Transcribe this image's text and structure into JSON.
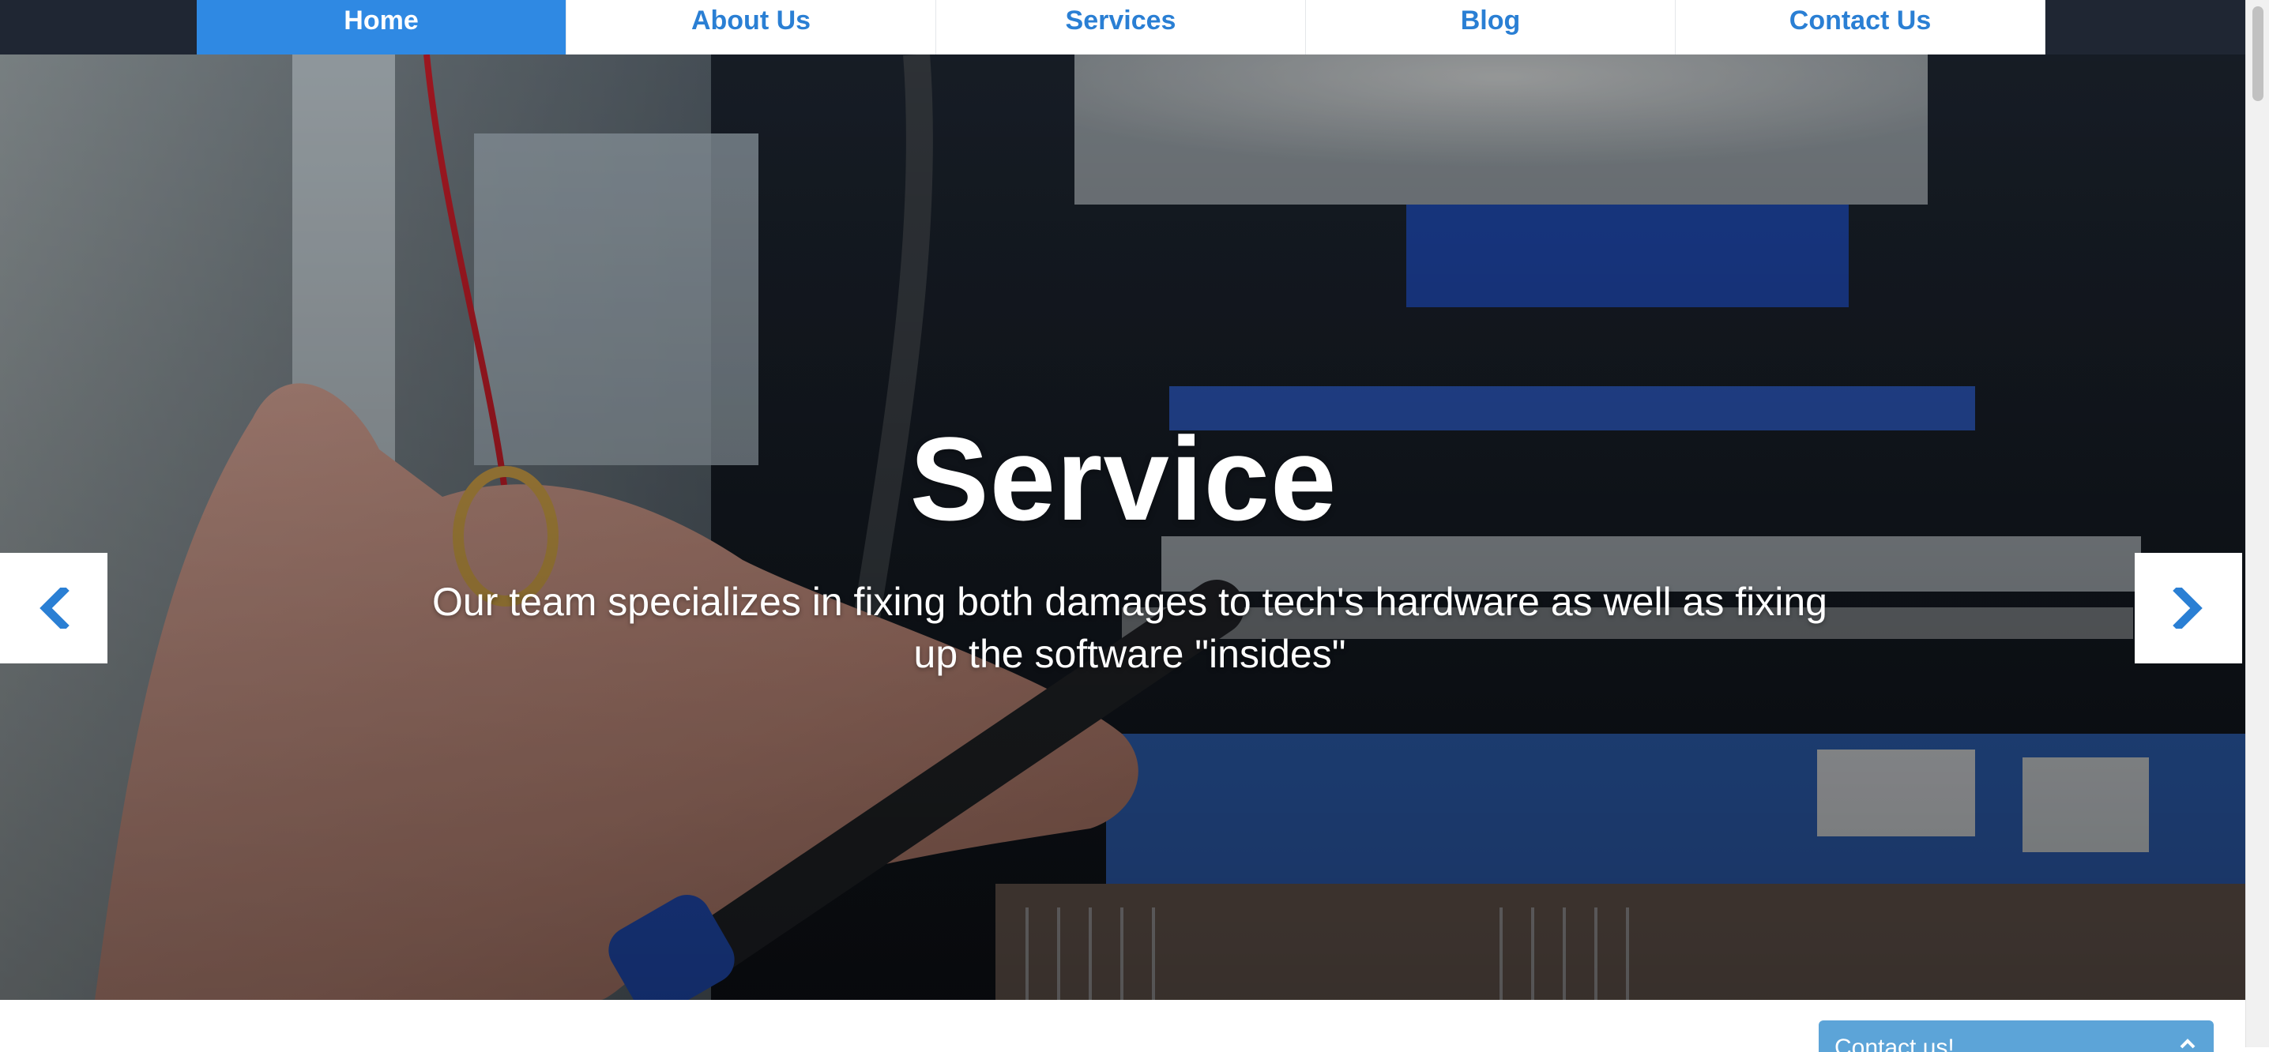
{
  "nav": {
    "items": [
      {
        "label": "Home"
      },
      {
        "label": "About Us"
      },
      {
        "label": "Services"
      },
      {
        "label": "Blog"
      },
      {
        "label": "Contact Us"
      }
    ],
    "active_index": 0
  },
  "hero": {
    "title": "Service",
    "text": "Our team specializes in fixing both damages to tech's hardware as well as fixing up the software \"insides\"",
    "prev_icon": "chevron-left-icon",
    "next_icon": "chevron-right-icon"
  },
  "contact_widget": {
    "label": "Contact us!",
    "icon": "chevron-up-icon"
  },
  "colors": {
    "topbar": "#1f2633",
    "accent": "#2f89e3",
    "nav_text": "#2a7fd4",
    "arrow_icon": "#2a7fd4",
    "contact_widget": "#5ca4d8"
  }
}
